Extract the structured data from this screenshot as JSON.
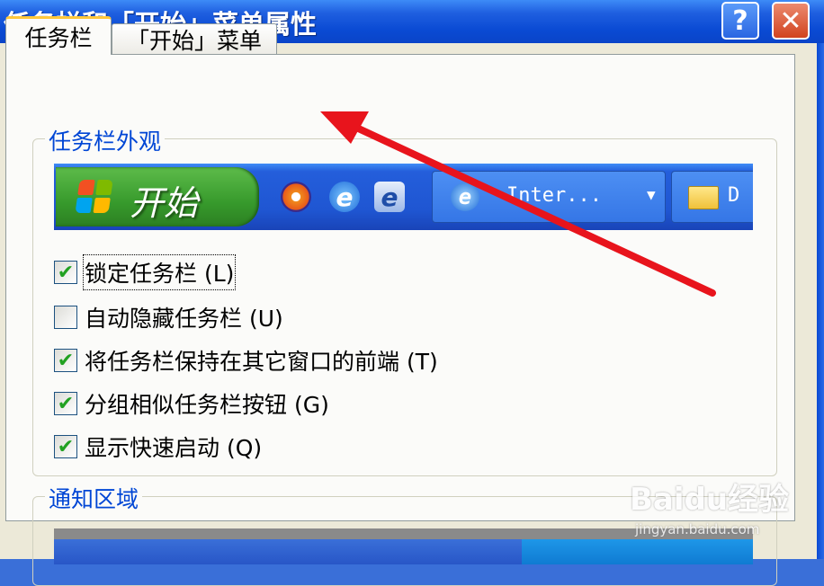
{
  "window": {
    "title": "任务栏和「开始」菜单属性",
    "help_label": "?",
    "close_label": "✕"
  },
  "tabs": [
    {
      "label": "任务栏",
      "active": true
    },
    {
      "label": "「开始」菜单",
      "active": false
    }
  ],
  "groups": {
    "appearance_title": "任务栏外观",
    "notification_title": "通知区域"
  },
  "taskbar_preview": {
    "start_label": "开始",
    "task_buttons": [
      {
        "label": "Inter...",
        "icon": "ie-icon"
      },
      {
        "label": "D",
        "icon": "folder-icon"
      }
    ],
    "quick_launch_icons": [
      "media-player-icon",
      "ie-icon",
      "outlook-express-icon"
    ]
  },
  "checkboxes": [
    {
      "label": "锁定任务栏",
      "hotkey": "(L)",
      "checked": true
    },
    {
      "label": "自动隐藏任务栏",
      "hotkey": "(U)",
      "checked": false
    },
    {
      "label": "将任务栏保持在其它窗口的前端",
      "hotkey": "(T)",
      "checked": true
    },
    {
      "label": "分组相似任务栏按钮",
      "hotkey": "(G)",
      "checked": true
    },
    {
      "label": "显示快速启动",
      "hotkey": "(Q)",
      "checked": true
    }
  ],
  "watermark": {
    "logo": "Baidu经验",
    "url": "jingyan.baidu.com"
  },
  "colors": {
    "title_bar": "#0a4ad3",
    "group_title": "#0046d5",
    "tab_highlight": "#ffc83c",
    "start_button": "#379a2c",
    "arrow": "#e8141c"
  }
}
